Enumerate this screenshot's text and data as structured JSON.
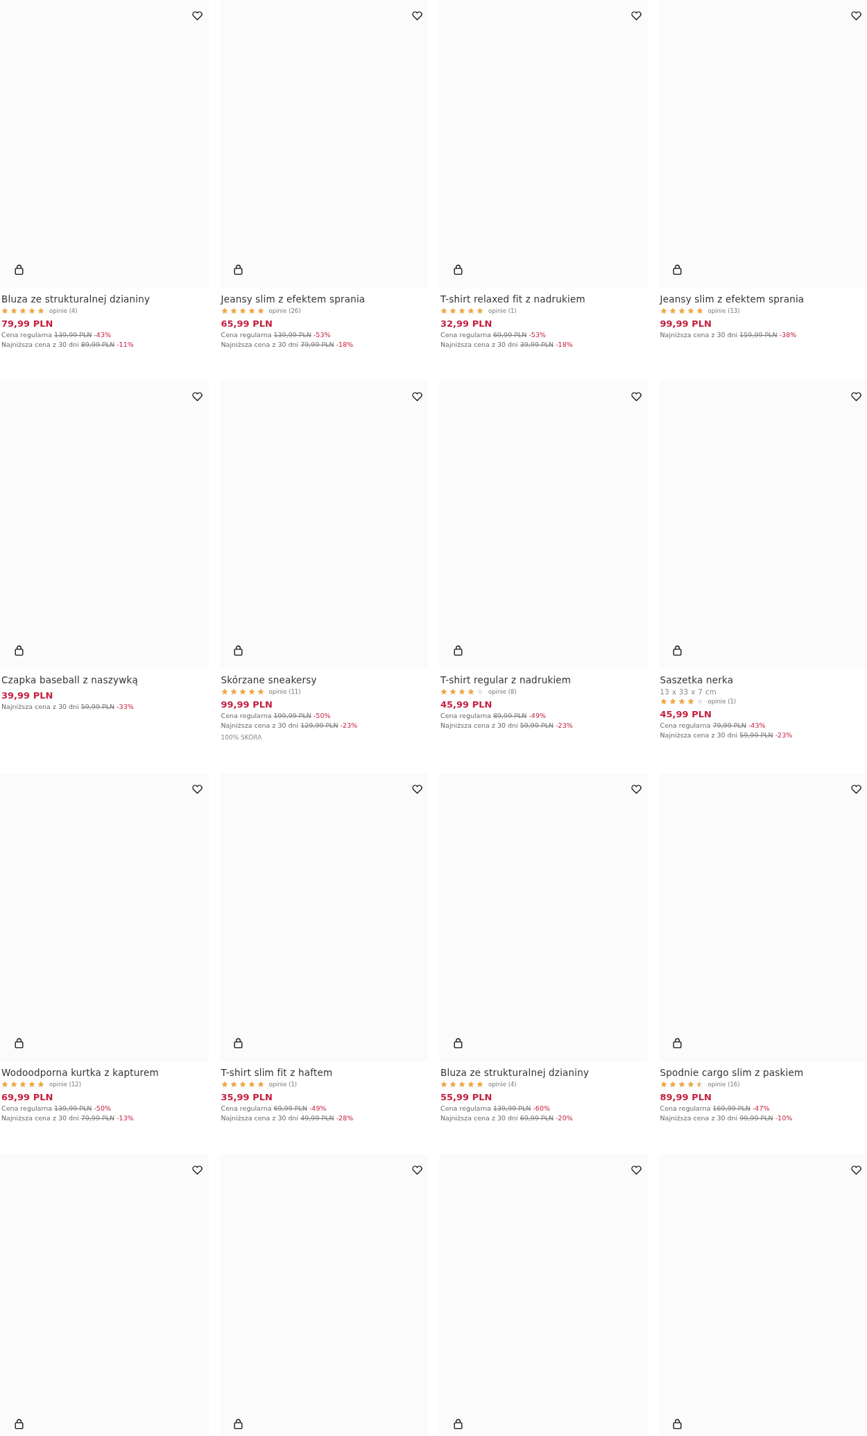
{
  "products": [
    {
      "kind": "full",
      "title": "Bluza ze strukturalnej dzianiny",
      "stars": 5,
      "reviews": "opinie (4)",
      "price": "79,99 PLN",
      "regular": {
        "label": "Cena regularna",
        "old": "139,99 PLN",
        "discount": "-43%"
      },
      "lowest": {
        "label": "Najniższa cena z 30 dni",
        "old": "89,99 PLN",
        "discount": "-11%"
      }
    },
    {
      "kind": "full",
      "title": "Jeansy slim z efektem sprania",
      "stars": 5,
      "reviews": "opinie (26)",
      "price": "65,99 PLN",
      "regular": {
        "label": "Cena regularna",
        "old": "139,99 PLN",
        "discount": "-53%"
      },
      "lowest": {
        "label": "Najniższa cena z 30 dni",
        "old": "79,99 PLN",
        "discount": "-18%"
      }
    },
    {
      "kind": "full",
      "title": "T-shirt relaxed fit z nadrukiem",
      "stars": 5,
      "reviews": "opinie (1)",
      "price": "32,99 PLN",
      "regular": {
        "label": "Cena regularna",
        "old": "69,99 PLN",
        "discount": "-53%"
      },
      "lowest": {
        "label": "Najniższa cena z 30 dni",
        "old": "39,99 PLN",
        "discount": "-18%"
      }
    },
    {
      "kind": "full",
      "title": "Jeansy slim z efektem sprania",
      "stars": 5,
      "reviews": "opinie (13)",
      "price": "99,99 PLN",
      "lowest": {
        "label": "Najniższa cena z 30 dni",
        "old": "159,99 PLN",
        "discount": "-38%"
      }
    },
    {
      "kind": "full",
      "title": "Czapka baseball z naszywką",
      "price": "39,99 PLN",
      "lowest": {
        "label": "Najniższa cena z 30 dni",
        "old": "59,99 PLN",
        "discount": "-33%"
      }
    },
    {
      "kind": "full",
      "title": "Skórzane sneakersy",
      "stars": 5,
      "reviews": "opinie (11)",
      "price": "99,99 PLN",
      "regular": {
        "label": "Cena regularna",
        "old": "199,99 PLN",
        "discount": "-50%"
      },
      "lowest": {
        "label": "Najniższa cena z 30 dni",
        "old": "129,99 PLN",
        "discount": "-23%"
      },
      "note": "100% SKÓRA"
    },
    {
      "kind": "full",
      "title": "T-shirt regular z nadrukiem",
      "stars": 4,
      "reviews": "opinie (8)",
      "price": "45,99 PLN",
      "regular": {
        "label": "Cena regularna",
        "old": "89,99 PLN",
        "discount": "-49%"
      },
      "lowest": {
        "label": "Najniższa cena z 30 dni",
        "old": "59,99 PLN",
        "discount": "-23%"
      }
    },
    {
      "kind": "full",
      "title": "Saszetka nerka",
      "size": "13 x 33 x 7 cm",
      "stars": 4,
      "reviews": "opinie (1)",
      "price": "45,99 PLN",
      "regular": {
        "label": "Cena regularna",
        "old": "79,99 PLN",
        "discount": "-43%"
      },
      "lowest": {
        "label": "Najniższa cena z 30 dni",
        "old": "59,99 PLN",
        "discount": "-23%"
      }
    },
    {
      "kind": "full",
      "title": "Wodoodporna kurtka z kapturem",
      "stars": 5,
      "reviews": "opinie (12)",
      "price": "69,99 PLN",
      "regular": {
        "label": "Cena regularna",
        "old": "139,99 PLN",
        "discount": "-50%"
      },
      "lowest": {
        "label": "Najniższa cena z 30 dni",
        "old": "79,99 PLN",
        "discount": "-13%"
      }
    },
    {
      "kind": "full",
      "title": "T-shirt slim fit z haftem",
      "stars": 5,
      "reviews": "opinie (1)",
      "price": "35,99 PLN",
      "regular": {
        "label": "Cena regularna",
        "old": "69,99 PLN",
        "discount": "-49%"
      },
      "lowest": {
        "label": "Najniższa cena z 30 dni",
        "old": "49,99 PLN",
        "discount": "-28%"
      }
    },
    {
      "kind": "full",
      "title": "Bluza ze strukturalnej dzianiny",
      "stars": 5,
      "reviews": "opinie (4)",
      "price": "55,99 PLN",
      "regular": {
        "label": "Cena regularna",
        "old": "139,99 PLN",
        "discount": "-60%"
      },
      "lowest": {
        "label": "Najniższa cena z 30 dni",
        "old": "69,99 PLN",
        "discount": "-20%"
      }
    },
    {
      "kind": "full",
      "title": "Spodnie cargo slim z paskiem",
      "stars": 4.5,
      "reviews": "opinie (16)",
      "price": "89,99 PLN",
      "regular": {
        "label": "Cena regularna",
        "old": "169,99 PLN",
        "discount": "-47%"
      },
      "lowest": {
        "label": "Najniższa cena z 30 dni",
        "old": "99,99 PLN",
        "discount": "-10%"
      }
    },
    {
      "kind": "image-only"
    },
    {
      "kind": "image-only"
    },
    {
      "kind": "image-only"
    },
    {
      "kind": "image-only"
    }
  ]
}
